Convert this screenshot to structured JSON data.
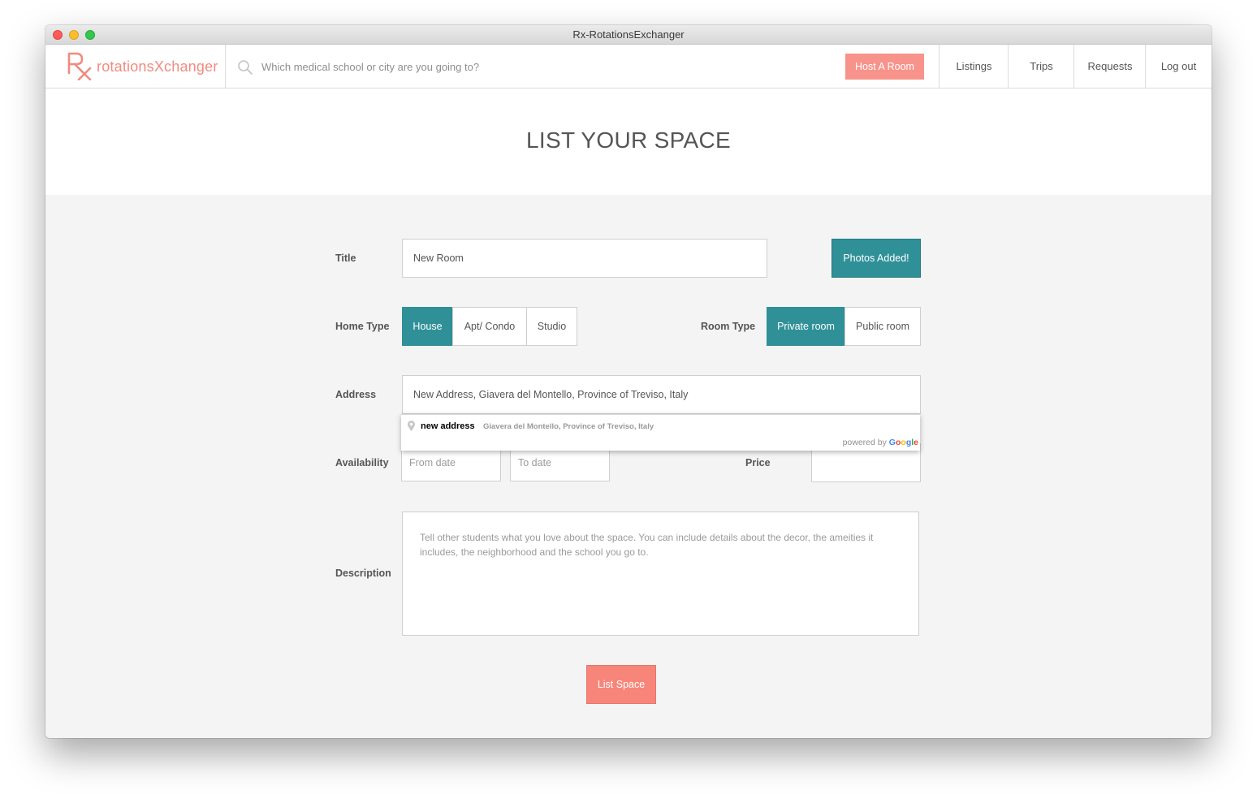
{
  "window": {
    "title": "Rx-RotationsExchanger"
  },
  "navbar": {
    "logo_mark": "Rx",
    "logo_text": "rotationsXchanger",
    "search_placeholder": "Which medical school or city are you going to?",
    "host_button": "Host A Room",
    "items": [
      {
        "label": "Listings"
      },
      {
        "label": "Trips"
      },
      {
        "label": "Requests"
      },
      {
        "label": "Log out"
      }
    ]
  },
  "page": {
    "heading": "LIST YOUR SPACE"
  },
  "form": {
    "title_label": "Title",
    "title_value": "New Room",
    "photos_button": "Photos Added!",
    "home_type_label": "Home Type",
    "home_types": [
      {
        "label": "House",
        "selected": true
      },
      {
        "label": "Apt/ Condo",
        "selected": false
      },
      {
        "label": "Studio",
        "selected": false
      }
    ],
    "room_type_label": "Room Type",
    "room_types": [
      {
        "label": "Private room",
        "selected": true
      },
      {
        "label": "Public room",
        "selected": false
      }
    ],
    "address_label": "Address",
    "address_value": "New Address, Giavera del Montello, Province of Treviso, Italy",
    "autocomplete": {
      "main_text": "new address",
      "secondary_text": "Giavera del Montello, Province of Treviso, Italy",
      "powered_by": "powered by",
      "provider_letters": [
        "G",
        "o",
        "o",
        "g",
        "l",
        "e"
      ]
    },
    "availability_label": "Availability",
    "from_date_placeholder": "From date",
    "to_date_placeholder": "To date",
    "price_label": "Price",
    "price_value": "",
    "description_label": "Description",
    "description_placeholder": "Tell other students what you love about the space. You can include details about the decor, the ameities it includes, the neighborhood and the school you go to.",
    "submit_button": "List Space"
  },
  "colors": {
    "teal": "#2f9098",
    "salmon": "#f7857a",
    "logo": "#f08b80",
    "background": "#f4f4f4"
  }
}
